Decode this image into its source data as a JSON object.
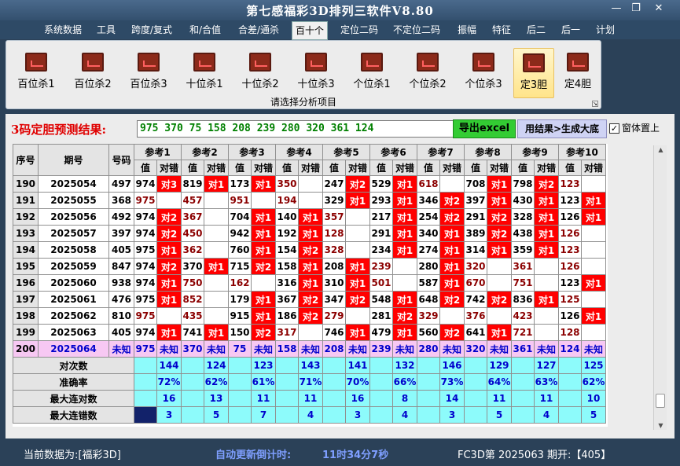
{
  "window": {
    "title": "第七感福彩3D排列三软件V8.80",
    "btn_min": "—",
    "btn_restore": "❐",
    "btn_close": "✕"
  },
  "menu": [
    "系统数据",
    "工具",
    "跨度/复式",
    "和/合值",
    "合差/通杀",
    "百十个",
    "定位二码",
    "不定位二码",
    "振幅",
    "特征",
    "后二",
    "后一",
    "计划"
  ],
  "menu_active": "百十个",
  "ribbon": {
    "buttons": [
      "百位杀1",
      "百位杀2",
      "百位杀3",
      "十位杀1",
      "十位杀2",
      "十位杀3",
      "个位杀1",
      "个位杀2",
      "个位杀3",
      "定3胆",
      "定4胆"
    ],
    "selected": "定3胆",
    "caption": "请选择分析项目",
    "icon": "chart-icon"
  },
  "prediction": {
    "label": "3码定胆预测结果:",
    "value": "975 370 75 158 208 239 280 320 361 124",
    "export_button": "导出excel",
    "generate_button": "用结果>生成大底",
    "checkbox_label": "窗体置上",
    "checkbox_checked": "✓"
  },
  "table": {
    "headers": {
      "seq": "序号",
      "period": "期号",
      "number": "号码",
      "refs": [
        "参考1",
        "参考2",
        "参考3",
        "参考4",
        "参考5",
        "参考6",
        "参考7",
        "参考8",
        "参考9",
        "参考10"
      ],
      "value": "值",
      "check": "对错"
    },
    "rows": [
      {
        "seq": "190",
        "period": "2025054",
        "number": "497",
        "cells": [
          [
            "974",
            "对3"
          ],
          [
            "819",
            "对1"
          ],
          [
            "173",
            "对1"
          ],
          [
            "350",
            ""
          ],
          [
            "247",
            "对2"
          ],
          [
            "529",
            "对1"
          ],
          [
            "618",
            ""
          ],
          [
            "708",
            "对1"
          ],
          [
            "798",
            "对2"
          ],
          [
            "123",
            ""
          ]
        ]
      },
      {
        "seq": "191",
        "period": "2025055",
        "number": "368",
        "cells": [
          [
            "975",
            ""
          ],
          [
            "457",
            ""
          ],
          [
            "951",
            ""
          ],
          [
            "194",
            ""
          ],
          [
            "329",
            "对1"
          ],
          [
            "293",
            "对1"
          ],
          [
            "346",
            "对2"
          ],
          [
            "397",
            "对1"
          ],
          [
            "430",
            "对1"
          ],
          [
            "123",
            "对1"
          ]
        ]
      },
      {
        "seq": "192",
        "period": "2025056",
        "number": "492",
        "cells": [
          [
            "974",
            "对2"
          ],
          [
            "367",
            ""
          ],
          [
            "704",
            "对1"
          ],
          [
            "140",
            "对1"
          ],
          [
            "357",
            ""
          ],
          [
            "217",
            "对1"
          ],
          [
            "254",
            "对2"
          ],
          [
            "291",
            "对2"
          ],
          [
            "328",
            "对1"
          ],
          [
            "126",
            "对1"
          ]
        ]
      },
      {
        "seq": "193",
        "period": "2025057",
        "number": "397",
        "cells": [
          [
            "974",
            "对2"
          ],
          [
            "450",
            ""
          ],
          [
            "942",
            "对1"
          ],
          [
            "192",
            "对1"
          ],
          [
            "128",
            ""
          ],
          [
            "291",
            "对1"
          ],
          [
            "340",
            "对1"
          ],
          [
            "389",
            "对2"
          ],
          [
            "438",
            "对1"
          ],
          [
            "126",
            ""
          ]
        ]
      },
      {
        "seq": "194",
        "period": "2025058",
        "number": "405",
        "cells": [
          [
            "975",
            "对1"
          ],
          [
            "362",
            ""
          ],
          [
            "760",
            "对1"
          ],
          [
            "154",
            "对2"
          ],
          [
            "328",
            ""
          ],
          [
            "234",
            "对1"
          ],
          [
            "274",
            "对1"
          ],
          [
            "314",
            "对1"
          ],
          [
            "359",
            "对1"
          ],
          [
            "123",
            ""
          ]
        ]
      },
      {
        "seq": "195",
        "period": "2025059",
        "number": "847",
        "cells": [
          [
            "974",
            "对2"
          ],
          [
            "370",
            "对1"
          ],
          [
            "715",
            "对2"
          ],
          [
            "158",
            "对1"
          ],
          [
            "208",
            "对1"
          ],
          [
            "239",
            ""
          ],
          [
            "280",
            "对1"
          ],
          [
            "320",
            ""
          ],
          [
            "361",
            ""
          ],
          [
            "126",
            ""
          ]
        ]
      },
      {
        "seq": "196",
        "period": "2025060",
        "number": "938",
        "cells": [
          [
            "974",
            "对1"
          ],
          [
            "750",
            ""
          ],
          [
            "162",
            ""
          ],
          [
            "316",
            "对1"
          ],
          [
            "310",
            "对1"
          ],
          [
            "501",
            ""
          ],
          [
            "587",
            "对1"
          ],
          [
            "670",
            ""
          ],
          [
            "751",
            ""
          ],
          [
            "123",
            "对1"
          ]
        ]
      },
      {
        "seq": "197",
        "period": "2025061",
        "number": "476",
        "cells": [
          [
            "975",
            "对1"
          ],
          [
            "852",
            ""
          ],
          [
            "179",
            "对1"
          ],
          [
            "367",
            "对2"
          ],
          [
            "347",
            "对2"
          ],
          [
            "548",
            "对1"
          ],
          [
            "648",
            "对2"
          ],
          [
            "742",
            "对2"
          ],
          [
            "836",
            "对1"
          ],
          [
            "125",
            ""
          ]
        ]
      },
      {
        "seq": "198",
        "period": "2025062",
        "number": "810",
        "cells": [
          [
            "975",
            ""
          ],
          [
            "435",
            ""
          ],
          [
            "915",
            "对1"
          ],
          [
            "186",
            "对2"
          ],
          [
            "279",
            ""
          ],
          [
            "281",
            "对2"
          ],
          [
            "329",
            ""
          ],
          [
            "376",
            ""
          ],
          [
            "423",
            ""
          ],
          [
            "126",
            "对1"
          ]
        ]
      },
      {
        "seq": "199",
        "period": "2025063",
        "number": "405",
        "cells": [
          [
            "974",
            "对1"
          ],
          [
            "741",
            "对1"
          ],
          [
            "150",
            "对2"
          ],
          [
            "317",
            ""
          ],
          [
            "746",
            "对1"
          ],
          [
            "479",
            "对1"
          ],
          [
            "560",
            "对2"
          ],
          [
            "641",
            "对1"
          ],
          [
            "721",
            ""
          ],
          [
            "128",
            ""
          ]
        ]
      }
    ],
    "pending": {
      "seq": "200",
      "period": "2025064",
      "number": "未知",
      "values": [
        "975",
        "370",
        "75",
        "158",
        "208",
        "239",
        "280",
        "320",
        "361",
        "124"
      ],
      "status": "未知"
    },
    "stats": [
      {
        "label": "对次数",
        "values": [
          "144",
          "124",
          "123",
          "143",
          "141",
          "132",
          "146",
          "129",
          "127",
          "125"
        ]
      },
      {
        "label": "准确率",
        "values": [
          "72%",
          "62%",
          "61%",
          "71%",
          "70%",
          "66%",
          "73%",
          "64%",
          "63%",
          "62%"
        ]
      },
      {
        "label": "最大连对数",
        "values": [
          "16",
          "13",
          "11",
          "11",
          "16",
          "8",
          "14",
          "11",
          "11",
          "10"
        ]
      },
      {
        "label": "最大连错数",
        "values": [
          "3",
          "5",
          "7",
          "4",
          "3",
          "4",
          "3",
          "5",
          "4",
          "5"
        ]
      }
    ]
  },
  "statusbar": {
    "current_data": "当前数据为:[福彩3D]",
    "countdown_label": "自动更新倒计时:",
    "countdown_value": "11时34分7秒",
    "issue": "FC3D第 2025063 期开:【405】"
  },
  "colors": {
    "hit": "#ff0000",
    "pending_row": "#f7c8f3",
    "stats_row": "#8dfbfb",
    "export_button": "#33cc33",
    "prediction_text": "#008000"
  }
}
